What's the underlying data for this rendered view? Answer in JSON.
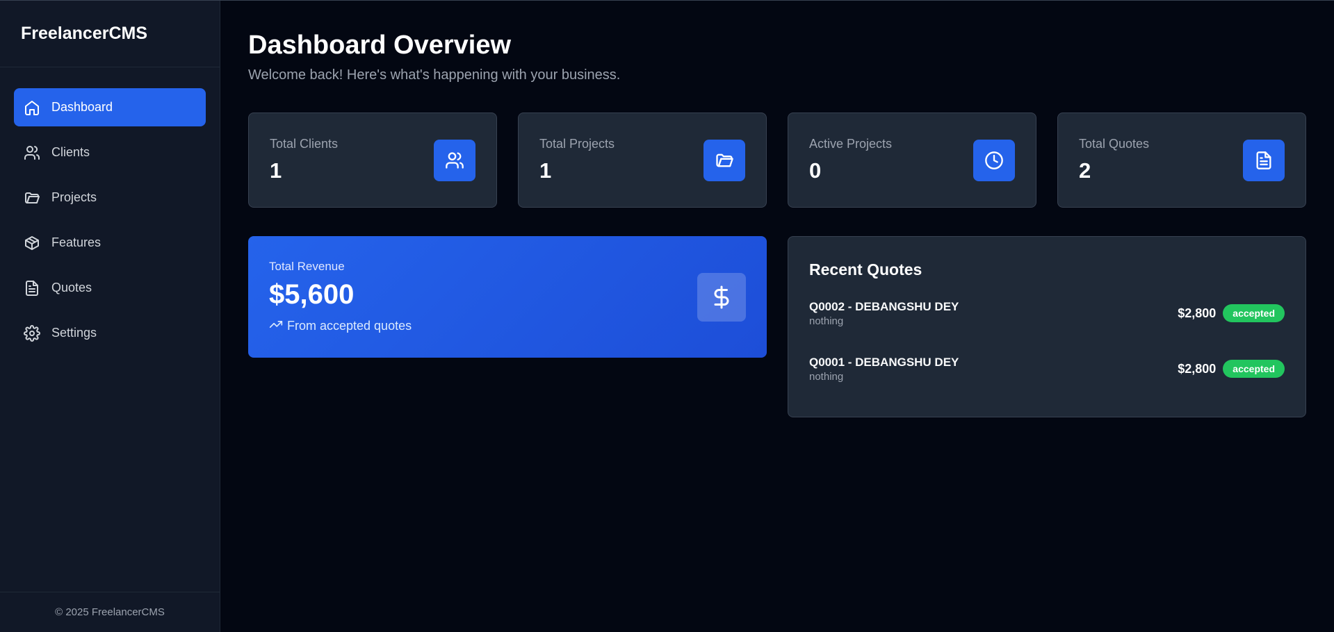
{
  "app": {
    "brand": "FreelancerCMS",
    "footer": "© 2025 FreelancerCMS"
  },
  "sidebar": {
    "items": [
      {
        "label": "Dashboard",
        "icon": "home-icon",
        "active": true
      },
      {
        "label": "Clients",
        "icon": "users-icon"
      },
      {
        "label": "Projects",
        "icon": "folder-icon"
      },
      {
        "label": "Features",
        "icon": "box-icon"
      },
      {
        "label": "Quotes",
        "icon": "file-text-icon"
      },
      {
        "label": "Settings",
        "icon": "gear-icon"
      }
    ]
  },
  "header": {
    "title": "Dashboard Overview",
    "subtitle": "Welcome back! Here's what's happening with your business."
  },
  "stats": [
    {
      "label": "Total Clients",
      "value": "1",
      "icon": "users-icon"
    },
    {
      "label": "Total Projects",
      "value": "1",
      "icon": "folder-open-icon"
    },
    {
      "label": "Active Projects",
      "value": "0",
      "icon": "clock-icon"
    },
    {
      "label": "Total Quotes",
      "value": "2",
      "icon": "file-text-icon"
    }
  ],
  "revenue": {
    "label": "Total Revenue",
    "value": "$5,600",
    "note": "From accepted quotes",
    "icon": "dollar-icon"
  },
  "recent_quotes": {
    "title": "Recent Quotes",
    "items": [
      {
        "name": "Q0002 - DEBANGSHU DEY",
        "description": "nothing",
        "amount": "$2,800",
        "status": "accepted"
      },
      {
        "name": "Q0001 - DEBANGSHU DEY",
        "description": "nothing",
        "amount": "$2,800",
        "status": "accepted"
      }
    ]
  },
  "colors": {
    "background": "#030712",
    "sidebar": "#111827",
    "card": "#1f2937",
    "accent": "#2563eb",
    "success": "#22c55e"
  }
}
